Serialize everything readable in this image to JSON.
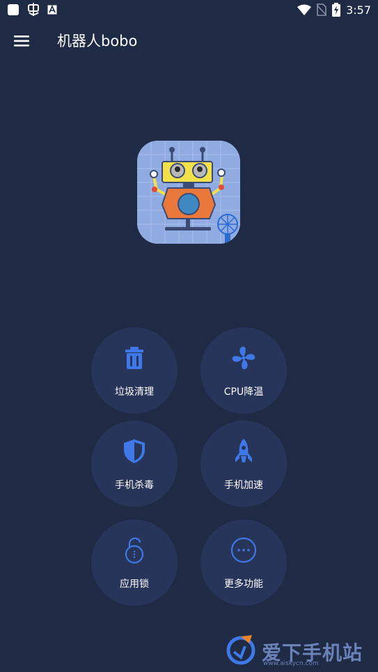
{
  "status_bar": {
    "time": "3:57",
    "left_icons": [
      "notification-square-icon",
      "bug-icon",
      "a-badge-icon"
    ],
    "right_icons": [
      "wifi-icon",
      "no-sim-icon",
      "battery-charging-icon"
    ]
  },
  "toolbar": {
    "title": "机器人bobo",
    "menu_icon": "hamburger-menu-icon"
  },
  "logo": {
    "icon": "robot-logo"
  },
  "features": [
    {
      "label": "垃圾清理",
      "icon": "trash-icon"
    },
    {
      "label": "CPU降温",
      "icon": "fan-icon"
    },
    {
      "label": "手机杀毒",
      "icon": "shield-icon"
    },
    {
      "label": "手机加速",
      "icon": "rocket-icon"
    },
    {
      "label": "应用锁",
      "icon": "lock-icon"
    },
    {
      "label": "更多功能",
      "icon": "more-icon"
    }
  ],
  "watermark": {
    "text": "爱下手机站",
    "url": "www.aiskycn.com"
  },
  "colors": {
    "background": "#1f2a44",
    "button_bg": "#28355a",
    "icon_blue": "#3f78e8",
    "text": "#ffffff"
  }
}
